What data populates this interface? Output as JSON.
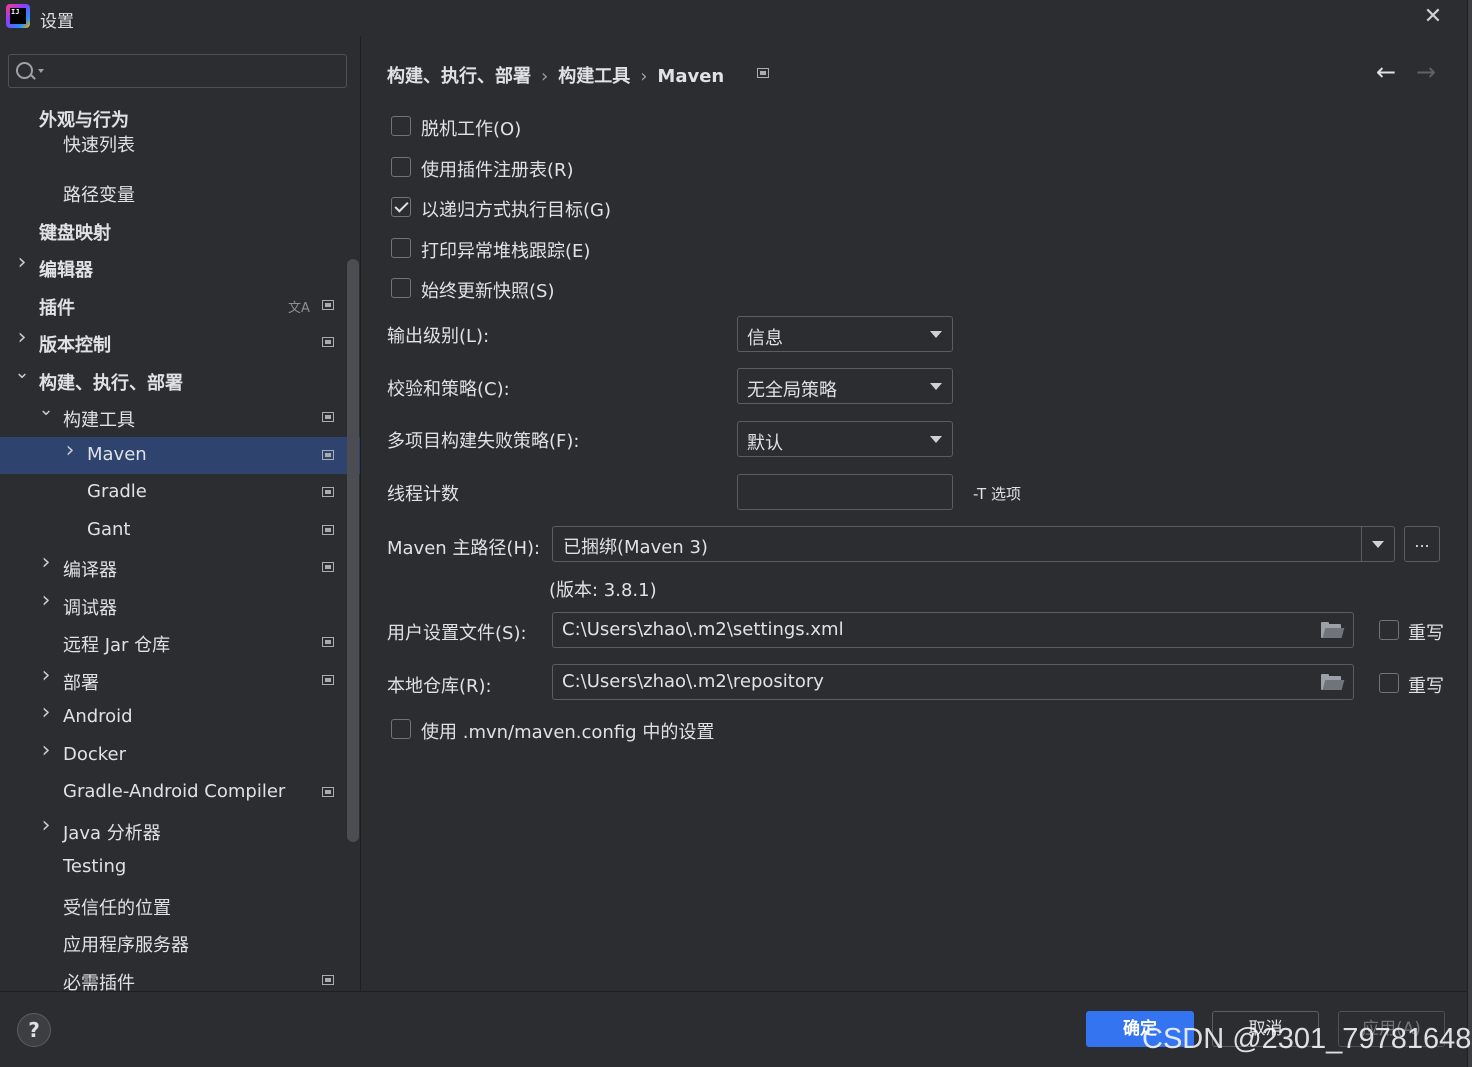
{
  "window": {
    "title": "设置",
    "app_icon_text": "IJ"
  },
  "search": {
    "value": ""
  },
  "sidebar": {
    "items": [
      {
        "label": "外观与行为",
        "indent": 0,
        "bold": true,
        "chevron": ""
      },
      {
        "label": "快速列表",
        "indent": 1,
        "bold": false,
        "chevron": ""
      },
      {
        "label": "路径变量",
        "indent": 1,
        "bold": false,
        "chevron": ""
      },
      {
        "label": "键盘映射",
        "indent": 0,
        "bold": true,
        "chevron": ""
      },
      {
        "label": "编辑器",
        "indent": 0,
        "bold": true,
        "chevron": "right"
      },
      {
        "label": "插件",
        "indent": 0,
        "bold": true,
        "chevron": "",
        "translate": true,
        "project": true
      },
      {
        "label": "版本控制",
        "indent": 0,
        "bold": true,
        "chevron": "right",
        "project": true
      },
      {
        "label": "构建、执行、部署",
        "indent": 0,
        "bold": true,
        "chevron": "down"
      },
      {
        "label": "构建工具",
        "indent": 1,
        "bold": false,
        "chevron": "down",
        "project": true
      },
      {
        "label": "Maven",
        "indent": 2,
        "bold": false,
        "chevron": "right",
        "project": true,
        "selected": true
      },
      {
        "label": "Gradle",
        "indent": 2,
        "bold": false,
        "chevron": "",
        "project": true
      },
      {
        "label": "Gant",
        "indent": 2,
        "bold": false,
        "chevron": "",
        "project": true
      },
      {
        "label": "编译器",
        "indent": 1,
        "bold": false,
        "chevron": "right",
        "project": true
      },
      {
        "label": "调试器",
        "indent": 1,
        "bold": false,
        "chevron": "right"
      },
      {
        "label": "远程 Jar 仓库",
        "indent": 1,
        "bold": false,
        "chevron": "",
        "project": true
      },
      {
        "label": "部署",
        "indent": 1,
        "bold": false,
        "chevron": "right",
        "project": true
      },
      {
        "label": "Android",
        "indent": 1,
        "bold": false,
        "chevron": "right"
      },
      {
        "label": "Docker",
        "indent": 1,
        "bold": false,
        "chevron": "right"
      },
      {
        "label": "Gradle-Android Compiler",
        "indent": 1,
        "bold": false,
        "chevron": "",
        "project": true
      },
      {
        "label": "Java 分析器",
        "indent": 1,
        "bold": false,
        "chevron": "right"
      },
      {
        "label": "Testing",
        "indent": 1,
        "bold": false,
        "chevron": ""
      },
      {
        "label": "受信任的位置",
        "indent": 1,
        "bold": false,
        "chevron": ""
      },
      {
        "label": "应用程序服务器",
        "indent": 1,
        "bold": false,
        "chevron": ""
      },
      {
        "label": "必需插件",
        "indent": 1,
        "bold": false,
        "chevron": "",
        "project": true
      }
    ]
  },
  "breadcrumb": {
    "parts": [
      "构建、执行、部署",
      "构建工具",
      "Maven"
    ],
    "separator": "›"
  },
  "nav": {
    "back": "←",
    "forward": "→"
  },
  "checkboxes": [
    {
      "label": "脱机工作(O)",
      "checked": false
    },
    {
      "label": "使用插件注册表(R)",
      "checked": false
    },
    {
      "label": "以递归方式执行目标(G)",
      "checked": true
    },
    {
      "label": "打印异常堆栈跟踪(E)",
      "checked": false
    },
    {
      "label": "始终更新快照(S)",
      "checked": false
    }
  ],
  "form": {
    "output_level": {
      "label": "输出级别(L):",
      "value": "信息"
    },
    "checksum_policy": {
      "label": "校验和策略(C):",
      "value": "无全局策略"
    },
    "multiproject_fail": {
      "label": "多项目构建失败策略(F):",
      "value": "默认"
    },
    "thread_count": {
      "label": "线程计数",
      "value": "",
      "note": "-T 选项"
    },
    "maven_home": {
      "label": "Maven 主路径(H):",
      "value": "已捆绑(Maven 3)",
      "browse": "...",
      "version": "(版本: 3.8.1)"
    },
    "user_settings": {
      "label": "用户设置文件(S):",
      "value": "C:\\Users\\zhao\\.m2\\settings.xml",
      "override": "重写",
      "override_checked": false
    },
    "local_repo": {
      "label": "本地仓库(R):",
      "value": "C:\\Users\\zhao\\.m2\\repository",
      "override": "重写",
      "override_checked": false
    },
    "mvn_config": {
      "label": "使用 .mvn/maven.config 中的设置",
      "checked": false
    }
  },
  "footer": {
    "help": "?",
    "ok": "确定",
    "cancel": "取消",
    "apply": "应用(A)"
  },
  "watermark": "CSDN @2301_79781648",
  "colors": {
    "selection": "#2e436e",
    "accent": "#3574f0",
    "background": "#2b2d30"
  }
}
